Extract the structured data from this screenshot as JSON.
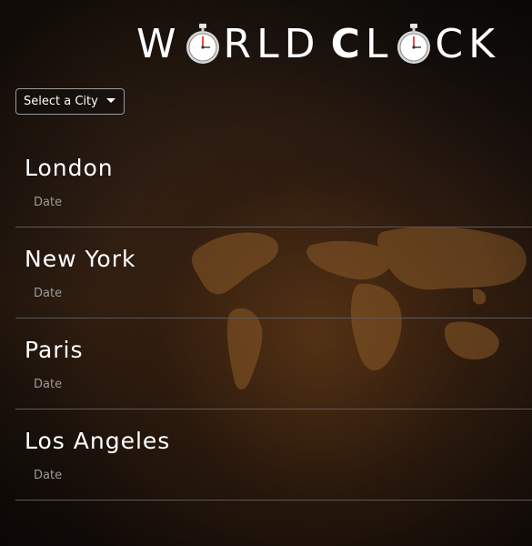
{
  "header": {
    "title_part1_pre": "W",
    "title_part1_post": "RLD",
    "title_part2_pre": "C",
    "title_part2_mid": "L",
    "title_part2_post": "CK",
    "icon": "stopwatch-icon"
  },
  "city_selector": {
    "label": "Select a City",
    "icon": "caret-down-icon"
  },
  "cities": [
    {
      "name": "London",
      "date": "Date"
    },
    {
      "name": "New York",
      "date": "Date"
    },
    {
      "name": "Paris",
      "date": "Date"
    },
    {
      "name": "Los Angeles",
      "date": "Date"
    }
  ],
  "colors": {
    "text": "#ffffff",
    "date_text": "#9a9a9a",
    "divider": "#5a5a5a",
    "background": "#1f1510"
  }
}
